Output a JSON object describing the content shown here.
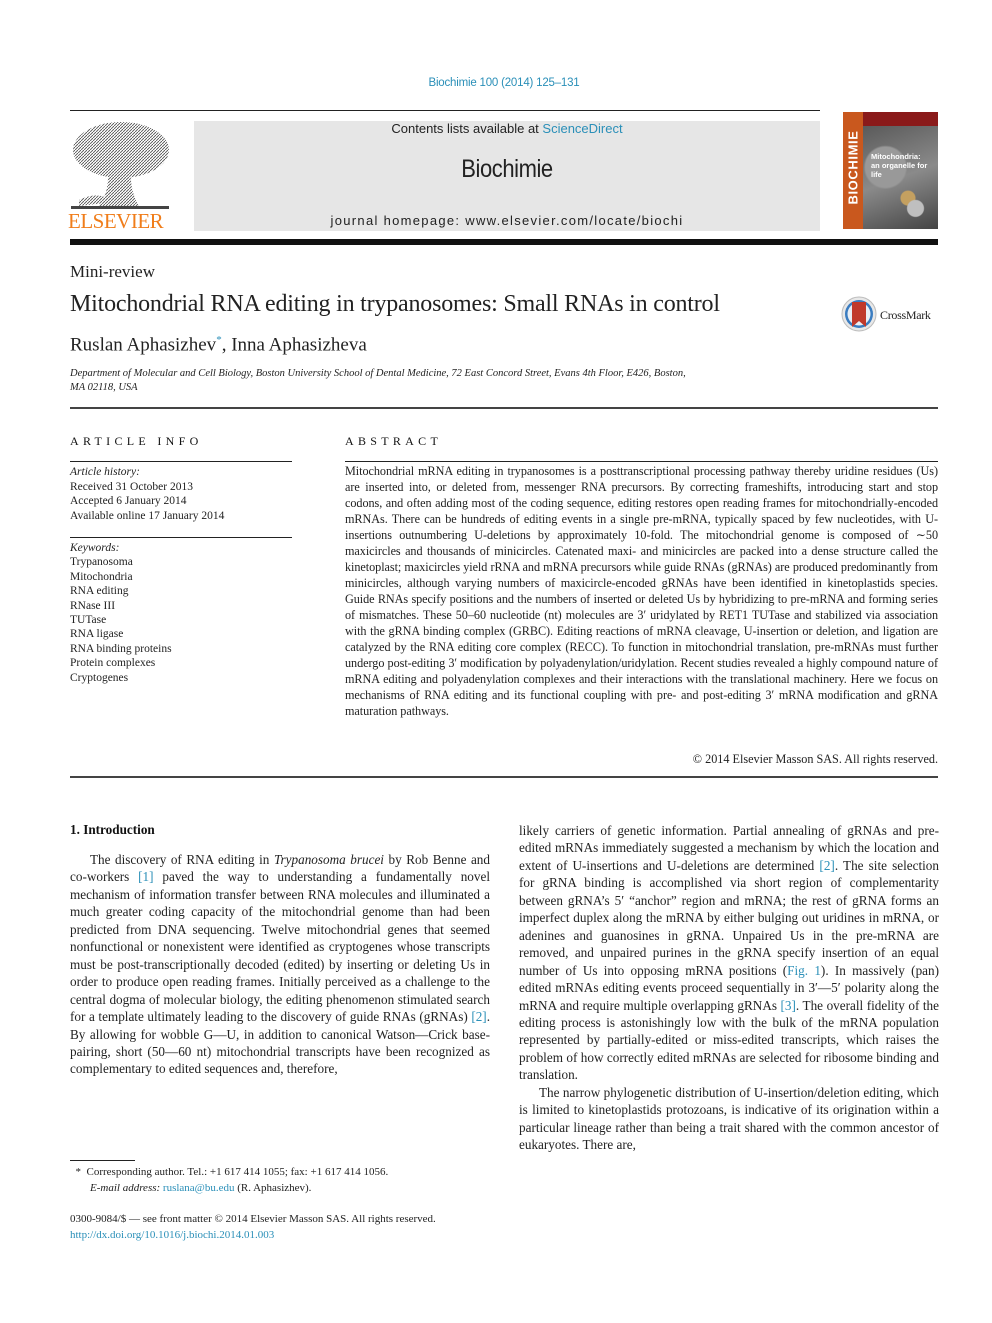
{
  "header": {
    "journal_reference": "Biochimie 100 (2014) 125–131",
    "contents_prefix": "Contents lists available at ",
    "contents_link": "ScienceDirect",
    "journal_name": "Biochimie",
    "homepage_prefix": "journal homepage: ",
    "homepage_url": "www.elsevier.com/locate/biochi",
    "publisher_logo_text": "ELSEVIER",
    "cover": {
      "spine_text": "BIOCHIMIE",
      "title_line1": "Mitochondria:",
      "title_line2": "an organelle for life"
    }
  },
  "article": {
    "type": "Mini-review",
    "title": "Mitochondrial RNA editing in trypanosomes: Small RNAs in control",
    "crossmark_label": "CrossMark",
    "authors": [
      {
        "name": "Ruslan Aphasizhev",
        "mark": "*"
      },
      {
        "name": "Inna Aphasizheva",
        "mark": ""
      }
    ],
    "author_separator": ", ",
    "affiliation_line1": "Department of Molecular and Cell Biology, Boston University School of Dental Medicine, 72 East Concord Street, Evans 4th Floor, E426, Boston,",
    "affiliation_line2": "MA 02118, USA"
  },
  "article_info": {
    "heading": "ARTICLE INFO",
    "history_label": "Article history:",
    "history": [
      "Received 31 October 2013",
      "Accepted 6 January 2014",
      "Available online 17 January 2014"
    ],
    "keywords_label": "Keywords:",
    "keywords": [
      "Trypanosoma",
      "Mitochondria",
      "RNA editing",
      "RNase III",
      "TUTase",
      "RNA ligase",
      "RNA binding proteins",
      "Protein complexes",
      "Cryptogenes"
    ]
  },
  "abstract": {
    "heading": "ABSTRACT",
    "text": "Mitochondrial mRNA editing in trypanosomes is a posttranscriptional processing pathway thereby uridine residues (Us) are inserted into, or deleted from, messenger RNA precursors. By correcting frameshifts, introducing start and stop codons, and often adding most of the coding sequence, editing restores open reading frames for mitochondrially-encoded mRNAs. There can be hundreds of editing events in a single pre-mRNA, typically spaced by few nucleotides, with U-insertions outnumbering U-deletions by approximately 10-fold. The mitochondrial genome is composed of ∼50 maxicircles and thousands of minicircles. Catenated maxi- and minicircles are packed into a dense structure called the kinetoplast; maxicircles yield rRNA and mRNA precursors while guide RNAs (gRNAs) are produced predominantly from minicircles, although varying numbers of maxicircle-encoded gRNAs have been identified in kinetoplastids species. Guide RNAs specify positions and the numbers of inserted or deleted Us by hybridizing to pre-mRNA and forming series of mismatches. These 50–60 nucleotide (nt) molecules are 3′ uridylated by RET1 TUTase and stabilized via association with the gRNA binding complex (GRBC). Editing reactions of mRNA cleavage, U-insertion or deletion, and ligation are catalyzed by the RNA editing core complex (RECC). To function in mitochondrial translation, pre-mRNAs must further undergo post-editing 3′ modification by polyadenylation/uridylation. Recent studies revealed a highly compound nature of mRNA editing and polyadenylation complexes and their interactions with the translational machinery. Here we focus on mechanisms of RNA editing and its functional coupling with pre- and post-editing 3′ mRNA modification and gRNA maturation pathways.",
    "copyright": "© 2014 Elsevier Masson SAS. All rights reserved."
  },
  "body": {
    "section_heading": "1.  Introduction",
    "left": {
      "p1_a": "The discovery of RNA editing in ",
      "p1_species": "Trypanosoma brucei",
      "p1_b": " by Rob Benne and co-workers ",
      "cite1": "[1]",
      "p1_c": " paved the way to understanding a fundamentally novel mechanism of information transfer between RNA molecules and illuminated a much greater coding capacity of the mitochondrial genome than had been predicted from DNA sequencing. Twelve mitochondrial genes that seemed nonfunctional or nonexistent were identified as cryptogenes whose transcripts must be post-transcriptionally decoded (edited) by inserting or deleting Us in order to produce open reading frames. Initially perceived as a challenge to the central dogma of molecular biology, the editing phenomenon stimulated search for a template ultimately leading to the discovery of guide RNAs (gRNAs) ",
      "cite2": "[2]",
      "p1_d": ". By allowing for wobble G—U, in addition to canonical Watson—Crick base-pairing, short (50—60 nt) mitochondrial transcripts have been recognized as complementary to edited sequences and, therefore,"
    },
    "right": {
      "p1_a": "likely carriers of genetic information. Partial annealing of gRNAs and pre-edited mRNAs immediately suggested a mechanism by which the location and extent of U-insertions and U-deletions are determined ",
      "cite2": "[2]",
      "p1_b": ". The site selection for gRNA binding is accomplished via short region of complementarity between gRNA’s 5′ “anchor” region and mRNA; the rest of gRNA forms an imperfect duplex along the mRNA by either bulging out uridines in mRNA, or adenines and guanosines in gRNA. Unpaired Us in the pre-mRNA are removed, and unpaired purines in the gRNA specify insertion of an equal number of Us into opposing mRNA positions (",
      "fig1": "Fig. 1",
      "p1_c": "). In massively (pan) edited mRNAs editing events proceed sequentially in 3′—5′ polarity along the mRNA and require multiple overlapping gRNAs ",
      "cite3": "[3]",
      "p1_d": ". The overall fidelity of the editing process is astonishingly low with the bulk of the mRNA population represented by partially-edited or miss-edited transcripts, which raises the problem of how correctly edited mRNAs are selected for ribosome binding and translation.",
      "p2": "The narrow phylogenetic distribution of U-insertion/deletion editing, which is limited to kinetoplastids protozoans, is indicative of its origination within a particular lineage rather than being a trait shared with the common ancestor of eukaryotes. There are,"
    }
  },
  "footnotes": {
    "corresponding_mark": "*",
    "corresponding": "Corresponding author. Tel.: +1 617 414 1055; fax: +1 617 414 1056.",
    "email_label": "E-mail address: ",
    "email": "ruslana@bu.edu",
    "email_suffix": " (R. Aphasizhev).",
    "front_matter": "0300-9084/$ — see front matter © 2014 Elsevier Masson SAS. All rights reserved.",
    "doi": "http://dx.doi.org/10.1016/j.biochi.2014.01.003"
  },
  "colors": {
    "link": "#2a8fb8",
    "elsevier_orange": "#f07d1a",
    "masthead_gray": "#e6e6e6",
    "cover_spine": "#c9581e"
  }
}
